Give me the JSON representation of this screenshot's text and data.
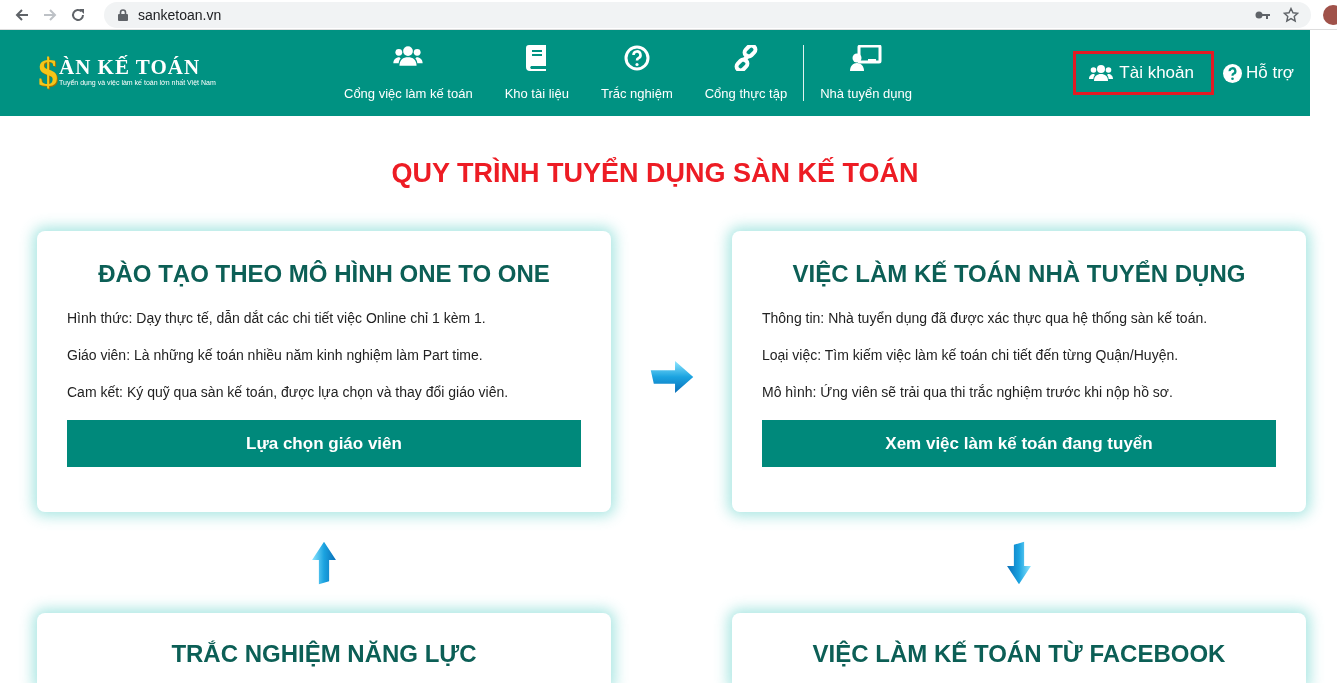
{
  "browser": {
    "url": "sanketoan.vn",
    "forward_disabled": true
  },
  "header": {
    "logo": {
      "mark": "$",
      "name": "ÀN KẾ TOÁN",
      "tagline": "Tuyển dụng và việc làm kế toán lớn nhất Việt Nam"
    },
    "nav": [
      {
        "label": "Cổng việc làm kế toán",
        "kind": "users",
        "divider_before": false
      },
      {
        "label": "Kho tài liệu",
        "kind": "book",
        "divider_before": false
      },
      {
        "label": "Trắc nghiệm",
        "kind": "question",
        "divider_before": false
      },
      {
        "label": "Cổng thực tập",
        "kind": "link",
        "divider_before": false
      },
      {
        "label": "Nhà tuyển dụng",
        "kind": "teacher",
        "divider_before": true
      }
    ],
    "account": {
      "label": "Tài khoản",
      "highlighted": true
    },
    "help": {
      "label": "Hỗ trợ"
    }
  },
  "title": "QUY TRÌNH TUYỂN DỤNG SÀN KẾ TOÁN",
  "cards": [
    {
      "title": "ĐÀO TẠO THEO MÔ HÌNH ONE TO ONE",
      "lines": [
        "Hình thức: Dạy thực tế, dẫn dắt các chi tiết việc Online chỉ 1 kèm 1.",
        "Giáo viên: Là những kế toán nhiều năm kinh nghiệm làm Part time.",
        "Cam kết: Ký quỹ qua sàn kế toán, được lựa chọn và thay đổi giáo viên."
      ],
      "button": "Lựa chọn giáo viên"
    },
    {
      "title": "VIỆC LÀM KẾ TOÁN NHÀ TUYỂN DỤNG",
      "lines": [
        "Thông tin: Nhà tuyển dụng đã được xác thực qua hệ thống sàn kế toán.",
        "Loại việc: Tìm kiếm việc làm kế toán chi tiết đến từng Quận/Huyện.",
        "Mô hình: Ứng viên sẽ trải qua thi trắc nghiệm trước khi nộp hồ sơ."
      ],
      "button": "Xem việc làm kế toán đang tuyển"
    },
    {
      "title": "TRẮC NGHIỆM NĂNG LỰC"
    },
    {
      "title": "VIỆC LÀM KẾ TOÁN TỪ FACEBOOK"
    }
  ]
}
